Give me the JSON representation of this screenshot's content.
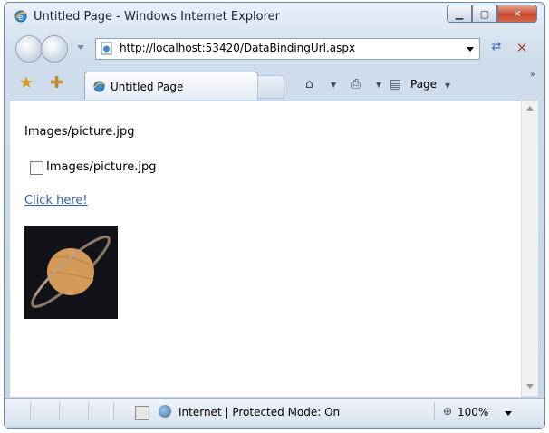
{
  "window": {
    "title": "Untitled Page - Windows Internet Explorer",
    "minimize_glyph": "▁",
    "maximize_glyph": "▢",
    "close_glyph": "✕"
  },
  "address_bar": {
    "url": "http://localhost:53420/DataBindingUrl.aspx"
  },
  "tab": {
    "label": "Untitled Page"
  },
  "toolbar": {
    "page_label": "Page",
    "home_glyph": "⌂",
    "print_glyph": "⎙",
    "page_glyph": "▤",
    "favorites_glyph": "★",
    "add_favorites_glyph": "✚",
    "dropdown_glyph": "▼",
    "overflow_glyph": "»",
    "refresh_glyph": "⇄",
    "stop_glyph": "✕"
  },
  "content": {
    "text_line": "Images/picture.jpg",
    "checkbox_label": "Images/picture.jpg",
    "checkbox_checked": false,
    "link_text": "Click here!",
    "image_name": "saturn-planet-image"
  },
  "status_bar": {
    "zone_text": "Internet | Protected Mode: On",
    "zoom_text": "100%",
    "zoom_glyph": "⊕"
  },
  "colors": {
    "link": "#3461a8",
    "planet": "#d39a5a",
    "image_bg": "#111318"
  }
}
